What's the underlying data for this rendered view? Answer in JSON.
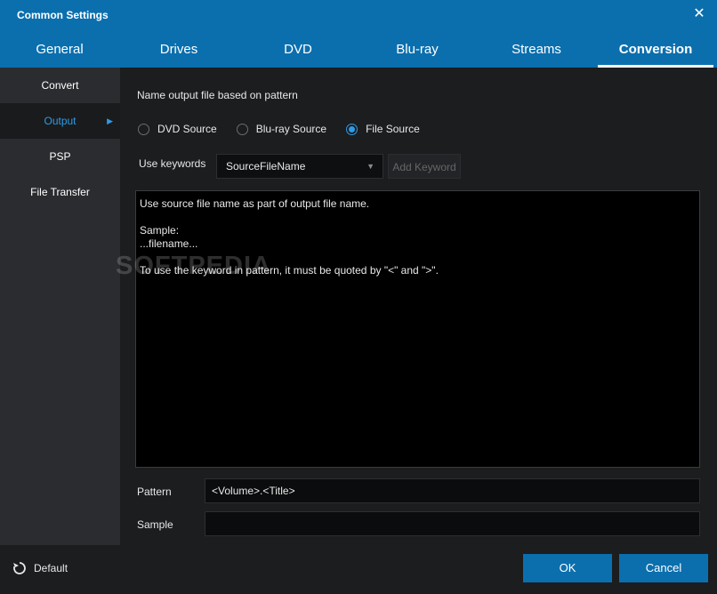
{
  "window": {
    "title": "Common Settings"
  },
  "tabs": [
    {
      "label": "General"
    },
    {
      "label": "Drives"
    },
    {
      "label": "DVD"
    },
    {
      "label": "Blu-ray"
    },
    {
      "label": "Streams"
    },
    {
      "label": "Conversion"
    }
  ],
  "sidebar": {
    "items": [
      {
        "label": "Convert"
      },
      {
        "label": "Output"
      },
      {
        "label": "PSP"
      },
      {
        "label": "File Transfer"
      }
    ]
  },
  "content": {
    "section_label": "Name output file based on pattern",
    "radios": [
      {
        "label": "DVD Source",
        "checked": false
      },
      {
        "label": "Blu-ray Source",
        "checked": false
      },
      {
        "label": "File Source",
        "checked": true
      }
    ],
    "keywords": {
      "label": "Use keywords",
      "selected": "SourceFileName",
      "add_button": "Add Keyword"
    },
    "info": {
      "line1": "Use source file name as part of output file name.",
      "line2": "Sample:",
      "line3": "...filename...",
      "line4": "To use the keyword in pattern, it must be quoted by \"<\" and \">\"."
    },
    "pattern": {
      "label": "Pattern",
      "value": "<Volume>.<Title>"
    },
    "sample": {
      "label": "Sample",
      "value": ""
    }
  },
  "bottom": {
    "default_label": "Default",
    "ok_label": "OK",
    "cancel_label": "Cancel"
  },
  "watermark": "SOFTPEDIA",
  "colors": {
    "accent": "#0b6fae",
    "active_text": "#2e9be6",
    "background": "#1c1d1f"
  }
}
